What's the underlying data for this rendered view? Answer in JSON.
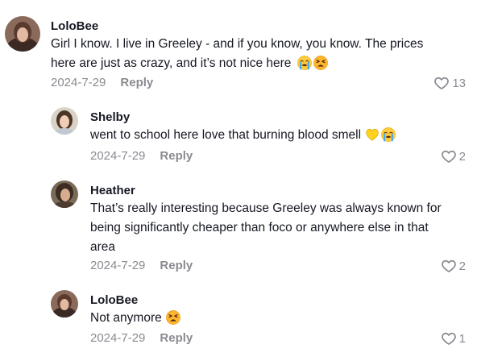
{
  "comments": [
    {
      "username": "LoloBee",
      "text_line1": "Girl I know. I live in Greeley - and if you know, you know. The prices",
      "text_line2": "here are just as crazy, and it’s not nice here",
      "emojis": [
        "loudly-crying-face",
        "tired-face"
      ],
      "date": "2024-7-29",
      "reply": "Reply",
      "likes": "13",
      "avatar_color": "#6b4b3e"
    },
    {
      "username": "Shelby",
      "text": "went to school here love that burning blood smell",
      "emojis": [
        "yellow-heart",
        "loudly-crying-face"
      ],
      "date": "2024-7-29",
      "reply": "Reply",
      "likes": "2",
      "avatar_color": "#c9b6a3"
    },
    {
      "username": "Heather",
      "text_line1": "That’s really interesting because Greeley was always known for",
      "text_line2": "being significantly cheaper than foco or anywhere else in that",
      "text_line3": "area",
      "date": "2024-7-29",
      "reply": "Reply",
      "likes": "2",
      "avatar_color": "#5a4636"
    },
    {
      "username": "LoloBee",
      "text": "Not anymore",
      "emojis": [
        "tired-face"
      ],
      "date": "2024-7-29",
      "reply": "Reply",
      "likes": "1",
      "avatar_color": "#6b4b3e"
    }
  ],
  "colors": {
    "text": "#161823",
    "secondary": "#8a8b91",
    "background": "#ffffff"
  }
}
